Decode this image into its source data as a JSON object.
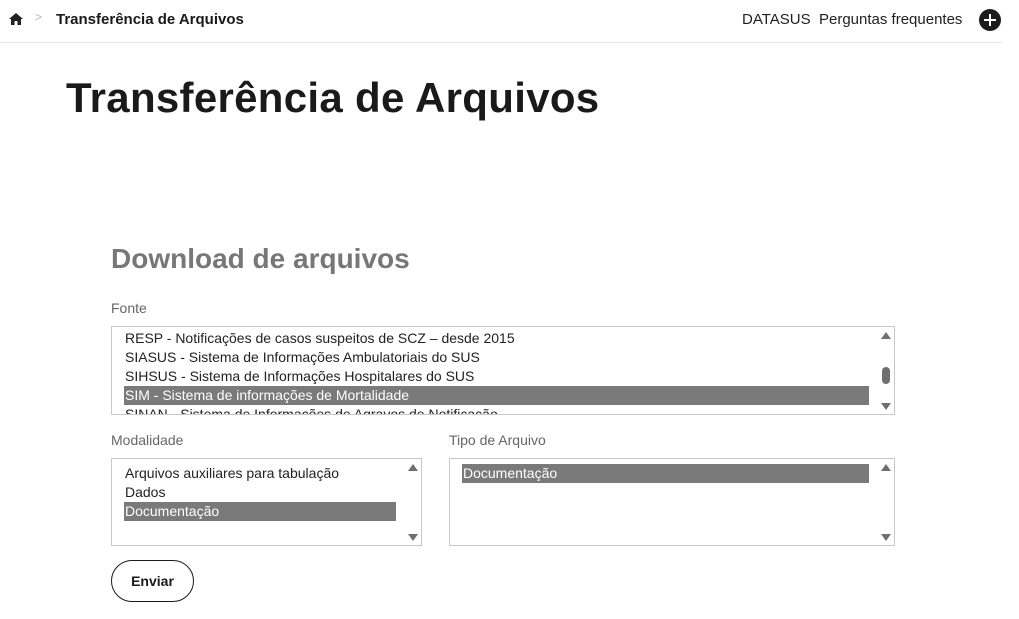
{
  "breadcrumb": {
    "separator": ">",
    "current": "Transferência de Arquivos"
  },
  "nav": {
    "datasus": "DATASUS",
    "faq": "Perguntas frequentes"
  },
  "page": {
    "title": "Transferência de Arquivos"
  },
  "download": {
    "title": "Download de arquivos",
    "fonte": {
      "label": "Fonte",
      "options": [
        "RESP - Notificações de casos suspeitos de SCZ – desde 2015",
        "SIASUS - Sistema de Informações Ambulatoriais do SUS",
        "SIHSUS - Sistema de Informações Hospitalares do SUS",
        "SIM - Sistema de informações de Mortalidade",
        "SINAN - Sistema de Informações de Agravos de Notificação"
      ],
      "selected": "SIM - Sistema de informações de Mortalidade"
    },
    "modalidade": {
      "label": "Modalidade",
      "options": [
        "Arquivos auxiliares para tabulação",
        "Dados",
        "Documentação"
      ],
      "selected": "Documentação"
    },
    "tipo_arquivo": {
      "label": "Tipo de Arquivo",
      "options": [
        "Documentação"
      ],
      "selected": "Documentação"
    },
    "submit_label": "Enviar"
  },
  "colors": {
    "selected_option_bg": "#7a7a7a",
    "title_dark": "#1a1a1a",
    "section_title_gray": "#777777"
  },
  "icons": {
    "home": "home-icon",
    "plus": "plus-icon",
    "scroll_up": "scroll-up-arrow",
    "scroll_down": "scroll-down-arrow"
  }
}
